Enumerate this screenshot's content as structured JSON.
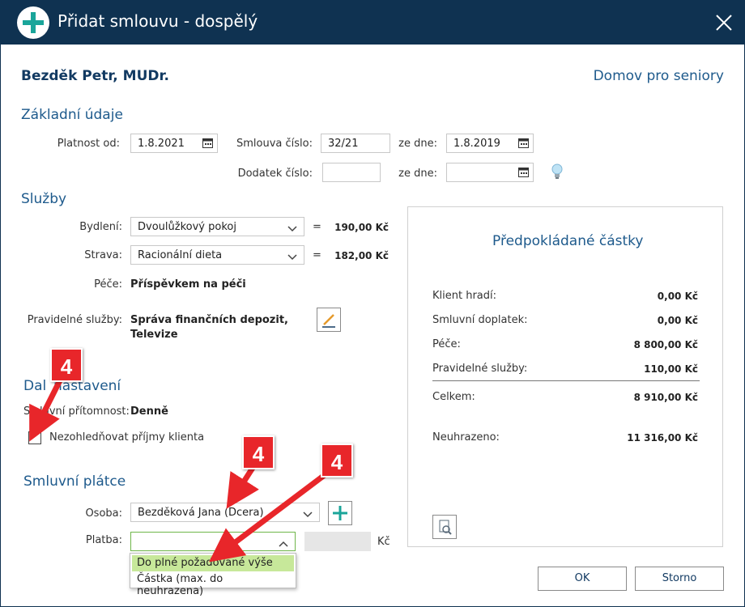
{
  "window": {
    "title": "Přidat smlouvu - dospělý",
    "icons": {
      "add": "plus-icon",
      "close": "close-icon"
    }
  },
  "header": {
    "client_name": "Bezděk Petr, MUDr.",
    "facility": "Domov pro seniory"
  },
  "basic": {
    "heading": "Základní údaje",
    "valid_from_label": "Platnost od:",
    "valid_from_value": "1.8.2021",
    "contract_no_label": "Smlouva číslo:",
    "contract_no_value": "32/21",
    "dated_label": "ze dne:",
    "dated_value": "1.8.2019",
    "amendment_label": "Dodatek číslo:",
    "amendment_value": "",
    "amendment_dated_label": "ze dne:",
    "amendment_dated_value": ""
  },
  "services": {
    "heading": "Služby",
    "housing_label": "Bydlení:",
    "housing_value": "Dvoulůžkový pokoj",
    "housing_amount": "190,00 Kč",
    "food_label": "Strava:",
    "food_value": "Racionální dieta",
    "food_amount": "182,00 Kč",
    "equals": "=",
    "care_label": "Péče:",
    "care_value": "Příspěvkem na péči",
    "regular_label": "Pravidelné služby:",
    "regular_value_1": "Správa finančních depozit,",
    "regular_value_2": "Televize"
  },
  "other": {
    "heading_visible": "nastavení",
    "heading_prefix": "Dal",
    "presence_label_prefix": "Sm",
    "presence_label": "luvní přítomnost:",
    "presence_value": "Denně",
    "ignore_income_label": "Nezohledňovat příjmy klienta",
    "ignore_income_checked": false
  },
  "payer": {
    "heading": "Smluvní plátce",
    "person_label": "Osoba:",
    "person_value": "Bezděková Jana (Dcera)",
    "payment_label": "Platba:",
    "payment_value": "",
    "currency": "Kč",
    "options": [
      "Do plné požadované výše",
      "Částka (max. do neuhrazena)"
    ],
    "highlighted_option": 0
  },
  "summary": {
    "title": "Předpokládané částky",
    "rows": [
      {
        "label": "Klient hradí:",
        "amount": "0,00 Kč"
      },
      {
        "label": "Smluvní doplatek:",
        "amount": "0,00 Kč"
      },
      {
        "label": "Péče:",
        "amount": "8 800,00 Kč"
      },
      {
        "label": "Pravidelné služby:",
        "amount": "110,00 Kč"
      }
    ],
    "total_label": "Celkem:",
    "total_amount": "8 910,00 Kč",
    "unpaid_label": "Neuhrazeno:",
    "unpaid_amount": "11 316,00 Kč"
  },
  "buttons": {
    "ok": "OK",
    "cancel": "Storno"
  },
  "annotations": {
    "badge_1": "4",
    "badge_2": "4",
    "badge_3": "4"
  },
  "colors": {
    "titlebar": "#0f3251",
    "accent": "#1e5a8c",
    "plus_green": "#1aa59a",
    "callout_red": "#e8262a",
    "highlight": "#c7e89a"
  }
}
